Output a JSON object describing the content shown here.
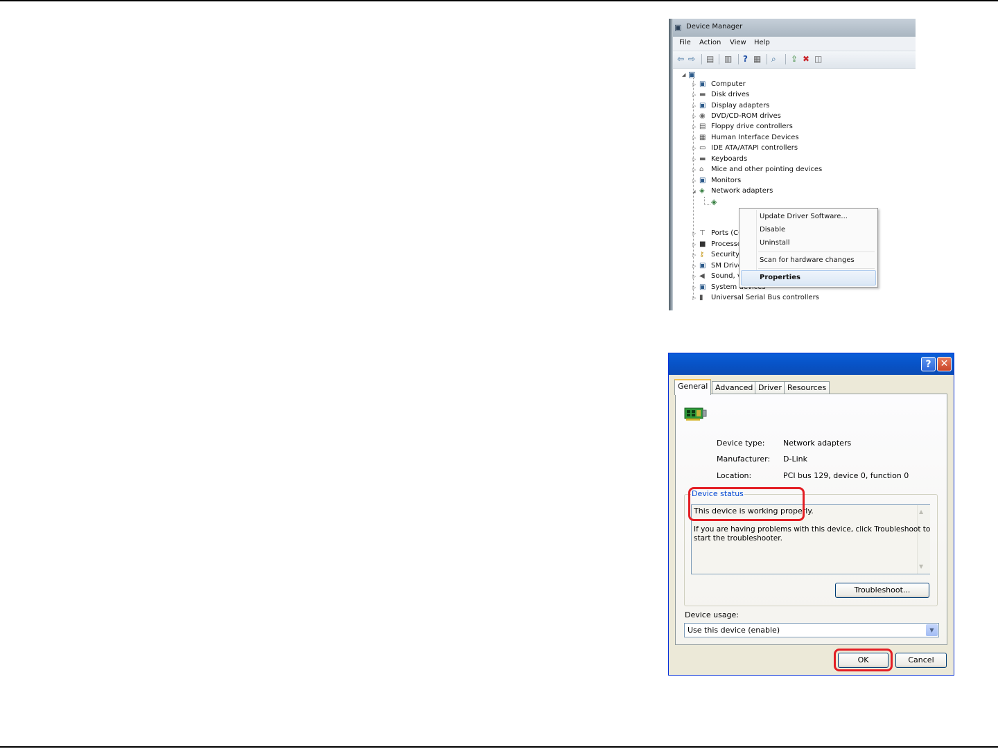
{
  "device_manager": {
    "title": "Device Manager",
    "menu": [
      "File",
      "Action",
      "View",
      "Help"
    ],
    "categories": [
      "Computer",
      "Disk drives",
      "Display adapters",
      "DVD/CD-ROM drives",
      "Floppy drive controllers",
      "Human Interface Devices",
      "IDE ATA/ATAPI controllers",
      "Keyboards",
      "Mice and other pointing devices",
      "Monitors",
      "Network adapters",
      "Ports (CO",
      "Processo",
      "Security",
      "SM Drive",
      "Sound, v",
      "System devices",
      "Universal Serial Bus controllers"
    ],
    "context_menu": [
      "Update Driver Software...",
      "Disable",
      "Uninstall",
      "Scan for hardware changes",
      "Properties"
    ]
  },
  "properties_dialog": {
    "tabs": [
      "General",
      "Advanced",
      "Driver",
      "Resources"
    ],
    "device_type_label": "Device type:",
    "device_type_value": "Network adapters",
    "manufacturer_label": "Manufacturer:",
    "manufacturer_value": "D-Link",
    "location_label": "Location:",
    "location_value": "PCI bus 129, device 0, function 0",
    "device_status_label": "Device status",
    "status_line1": "This device is working properly.",
    "status_line2": "If you are having problems with this device, click Troubleshoot to",
    "status_line3": "start the troubleshooter.",
    "troubleshoot_button": "Troubleshoot...",
    "device_usage_label": "Device usage:",
    "device_usage_value": "Use this device (enable)",
    "ok_button": "OK",
    "cancel_button": "Cancel"
  },
  "colors": {
    "highlight": "#e31e24",
    "xp_title": "#0a5ed8",
    "dialog_bg": "#ece9d8"
  }
}
